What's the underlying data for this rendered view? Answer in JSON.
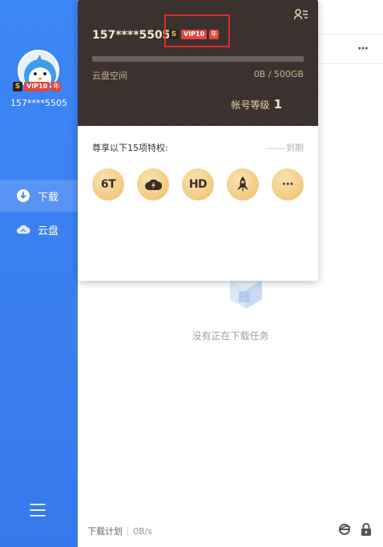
{
  "user": {
    "name": "157****5505",
    "masked_name_popup": "157****5505",
    "vip_label": "VIP10",
    "vip_icon_glyph": "S",
    "year_label": "年"
  },
  "sidebar": {
    "items": [
      {
        "label": "下载",
        "icon": "download-icon",
        "active": true
      },
      {
        "label": "云盘",
        "icon": "cloud-icon",
        "active": false
      }
    ]
  },
  "popup": {
    "storage_label": "云盘空间",
    "storage_value": "0B / 500GB",
    "storage_used_fraction": 0,
    "level_label": "帐号等级",
    "level_value": "1",
    "perks_title": "尊享以下15项特权:",
    "perks_expire": "------到期",
    "perks": [
      {
        "name": "6t-perk-icon",
        "text": "6T"
      },
      {
        "name": "fast-cloud-icon",
        "text": ""
      },
      {
        "name": "hd-perk-icon",
        "text": "HD"
      },
      {
        "name": "rocket-icon",
        "text": ""
      },
      {
        "name": "more-perks-icon",
        "text": "···"
      }
    ]
  },
  "main": {
    "more_label": "···",
    "empty_text": "没有正在下载任务"
  },
  "footer": {
    "plan_label": "下载计划",
    "speed": "0B/s"
  },
  "colors": {
    "sidebar": "#3d86f5",
    "popup_header": "#3b3230",
    "gold": "#f3c97f",
    "vip_red": "#e0463e",
    "highlight": "#e02a2a"
  }
}
